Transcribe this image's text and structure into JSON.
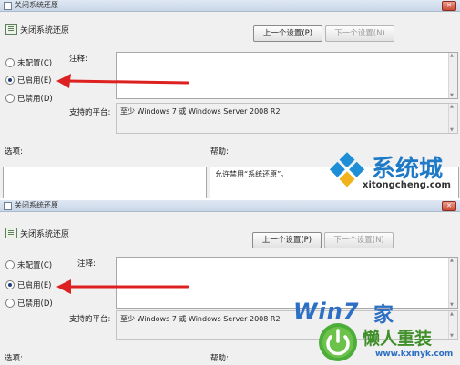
{
  "window": {
    "title": "关闭系统还原",
    "close_glyph": "✕"
  },
  "policy": {
    "name": "关闭系统还原",
    "prev_button": "上一个设置(P)",
    "next_button": "下一个设置(N)"
  },
  "radios": {
    "not_configured": "未配置(C)",
    "enabled": "已启用(E)",
    "disabled": "已禁用(D)",
    "selected": "enabled"
  },
  "labels": {
    "comment": "注释:",
    "supported_on": "支持的平台:",
    "options": "选项:",
    "help": "帮助:"
  },
  "supported_platforms": "至少 Windows 7 或 Windows Server 2008 R2",
  "help_text": "允许禁用“系统还原”。",
  "accent_color": "#dd2020",
  "watermarks": {
    "top": {
      "brand": "系统城",
      "url": "xitongcheng.com"
    },
    "bottom": {
      "brand_prefix": "Win7",
      "brand_suffix": "家",
      "slogan": "懒人重装",
      "url": "www.kxinyk.com"
    }
  }
}
